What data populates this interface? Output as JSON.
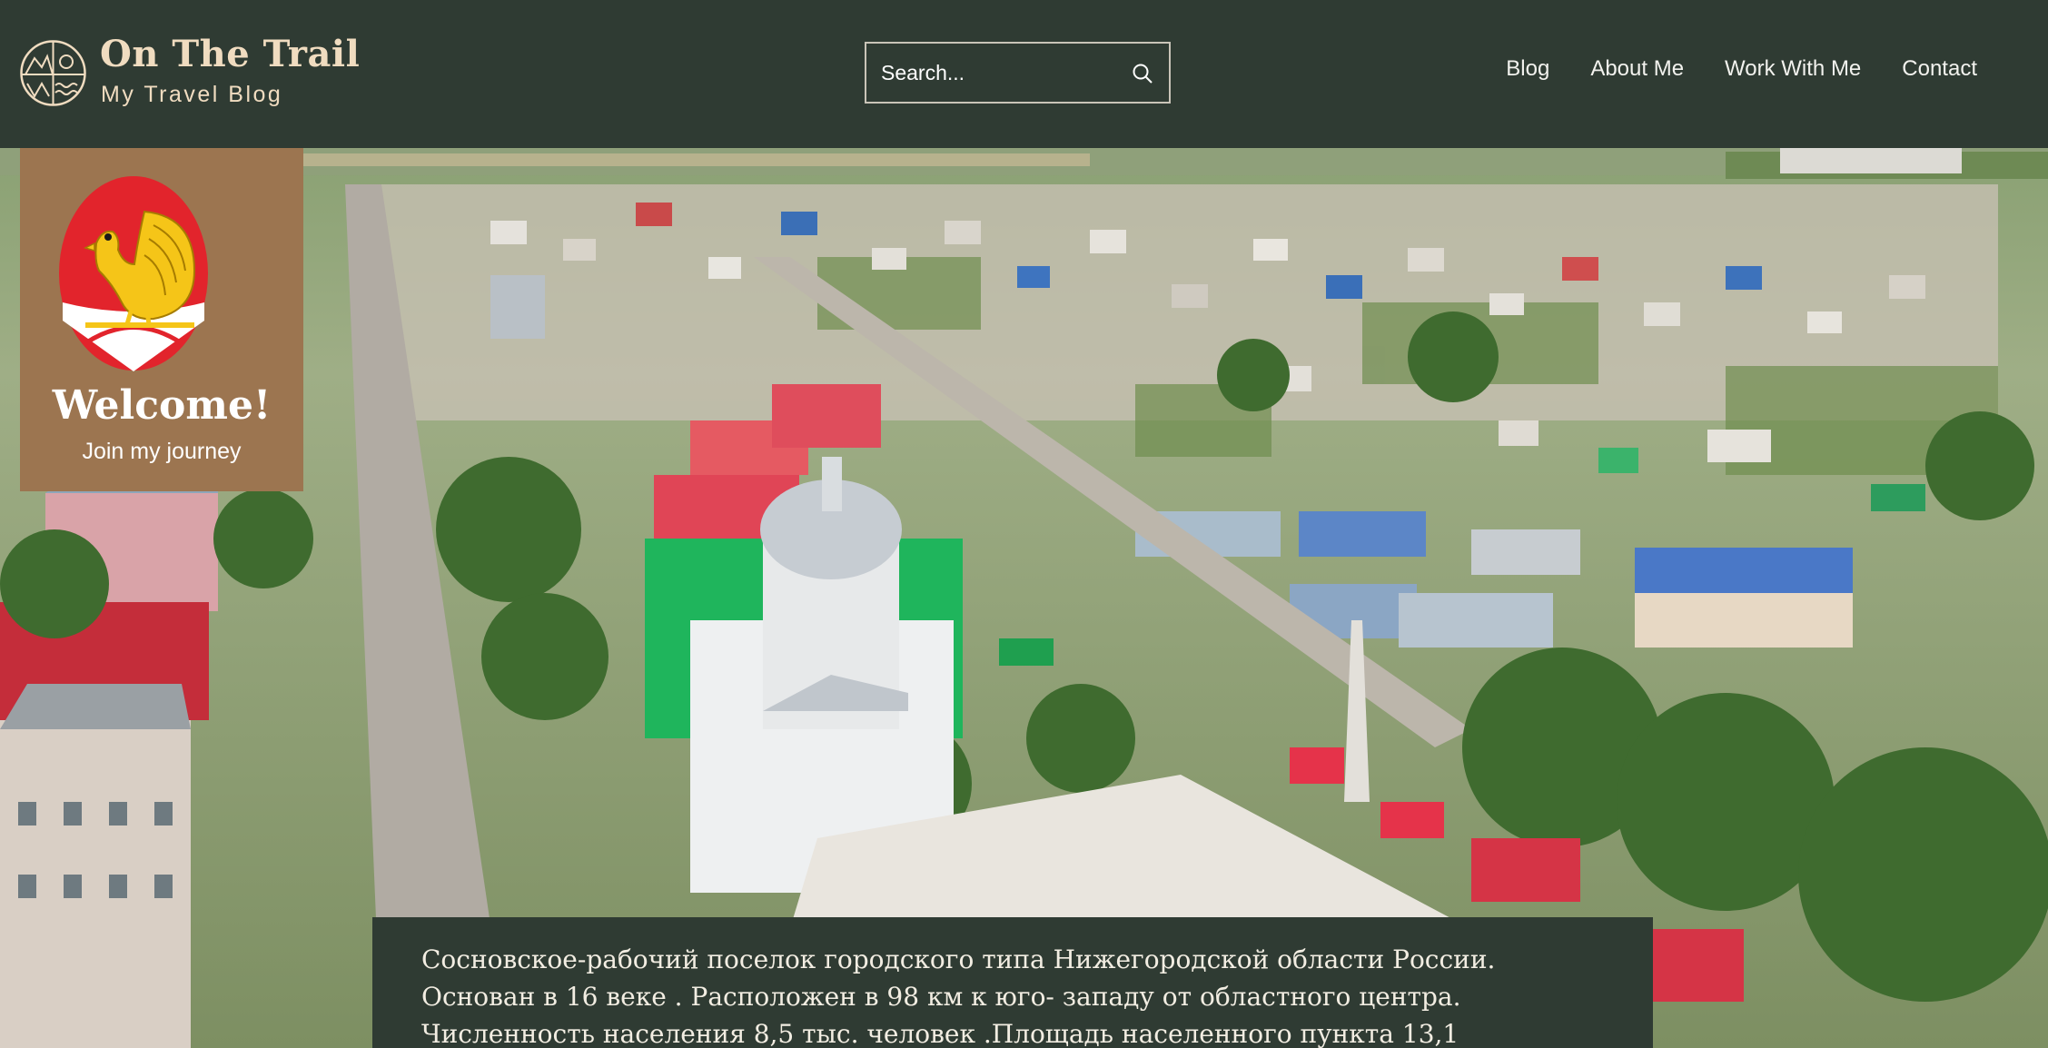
{
  "header": {
    "brand_title": "On The Trail",
    "brand_subtitle": "My Travel Blog",
    "logo_icon": "mountain-sun-sea-circle-icon"
  },
  "search": {
    "placeholder": "Search...",
    "icon": "search-icon"
  },
  "nav": {
    "items": [
      {
        "label": "Blog"
      },
      {
        "label": "About Me"
      },
      {
        "label": "Work With Me"
      },
      {
        "label": "Contact"
      }
    ]
  },
  "welcome": {
    "title": "Welcome!",
    "subtitle": "Join my journey",
    "emblem_icon": "turkey-coat-of-arms-icon"
  },
  "hero": {
    "image_subject": "aerial-town-view-photo"
  },
  "description": {
    "line1": "Сосновское-рабочий поселок городского типа Нижегородской области России.",
    "line2": "Основан в 16 веке . Расположен в 98 км к юго- западу от областного центра.",
    "line3": "Численность населения 8,5 тыс. человек .Площадь населенного пункта 13,1"
  },
  "colors": {
    "header_bg": "#2f3b33",
    "brand_text": "#f0dcc0",
    "card_bg": "#9c7550",
    "emblem_red": "#e2242c",
    "emblem_gold": "#f5c518"
  }
}
